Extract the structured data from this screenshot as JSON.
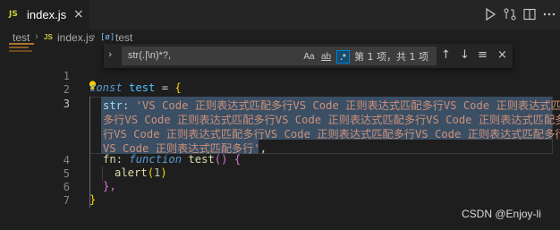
{
  "tab": {
    "badge": "JS",
    "label": "index.js",
    "close": "×"
  },
  "breadcrumb": {
    "folder": "test",
    "sep1": "›",
    "file_badge": "JS",
    "file": "index.js",
    "sep2": "›",
    "symbol_icon": "[ø]",
    "symbol": "test"
  },
  "find": {
    "toggle": "›",
    "query": "str(.|\\n)*?,",
    "opt_case": "Aa",
    "opt_word": "ab",
    "opt_regex": ".*",
    "result": "第 1 项，共 1 项",
    "prev": "↑",
    "next": "↓",
    "in_selection": "≡",
    "close": "×"
  },
  "line_numbers": [
    "1",
    "2",
    "3",
    "4",
    "5",
    "6",
    "7"
  ],
  "code": {
    "l2_const": "const",
    "l2_name": "test",
    "l2_eq": "=",
    "l2_brace": "{",
    "l3_key": "str",
    "l3_colon": ":",
    "l3_str_a": "'VS Code 正则表达式匹配多行VS Code 正则表达式匹配多行VS Code 正则表达式匹配",
    "l3_str_b": "多行VS Code 正则表达式匹配多行VS Code 正则表达式匹配多行VS Code 正则表达式匹配多",
    "l3_str_c": "行VS Code 正则表达式匹配多行VS Code 正则表达式匹配多行VS Code 正则表达式匹配多行",
    "l3_str_d": "VS Code 正则表达式匹配多行'",
    "l3_comma": ",",
    "l4_key": "fn",
    "l4_colon": ":",
    "l4_function": "function",
    "l4_name": "test",
    "l4_parens": "()",
    "l4_brace": "{",
    "l5_call": "alert",
    "l5_open": "(",
    "l5_arg": "1",
    "l5_close": ")",
    "l6": "},",
    "l7": "}"
  },
  "watermark": "CSDN @Enjoy-li",
  "colors": {
    "accent": "#007fd4",
    "selection": "#3a4e64",
    "keyword": "#569cd6",
    "string": "#ce9178"
  }
}
